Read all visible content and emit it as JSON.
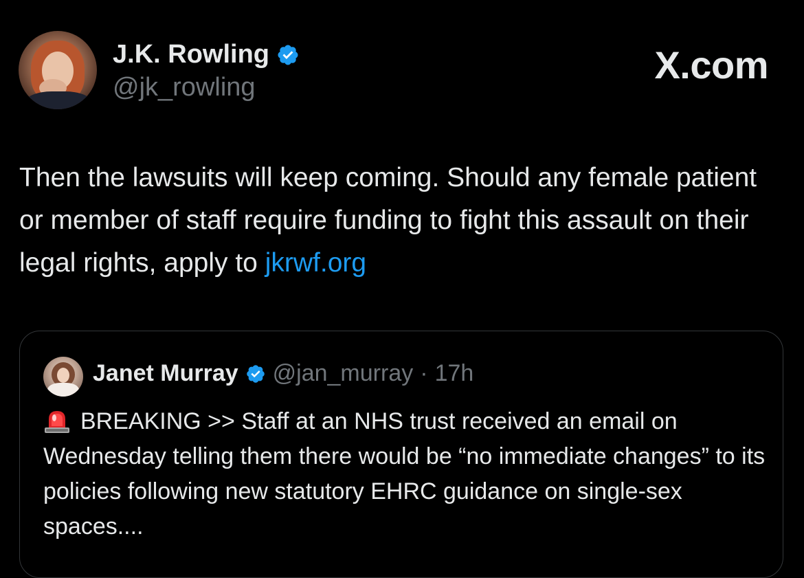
{
  "author": {
    "name": "J.K. Rowling",
    "handle": "@jk_rowling",
    "verified_color": "#1d9bf0"
  },
  "brand": "X.com",
  "tweet": {
    "text_before_link": "Then the lawsuits will keep coming. Should any female patient or member of staff require funding to fight this assault on their legal rights, apply to ",
    "link_text": "jkrwf.org",
    "link_color": "#1d9bf0"
  },
  "quote": {
    "name": "Janet Murray",
    "handle": "@jan_murray",
    "separator": "·",
    "time": "17h",
    "icon": "siren-icon",
    "text": "BREAKING  >>  Staff at an NHS trust received an email on Wednesday telling them there would be “no immediate changes” to its policies following new statutory EHRC guidance on single-sex spaces...."
  },
  "colors": {
    "background": "#000000",
    "text": "#e7e9ea",
    "secondary": "#71767b",
    "border": "#333639"
  }
}
